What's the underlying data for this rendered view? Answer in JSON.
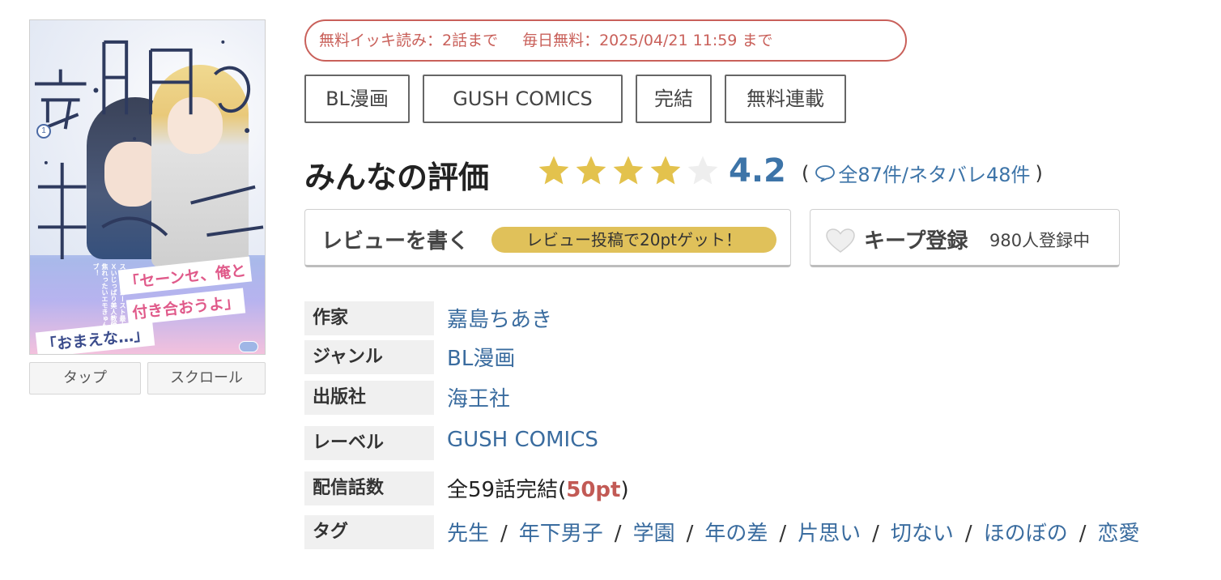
{
  "cover": {
    "volume": "1",
    "band_line1": "「セーンセ、俺と",
    "band_line2": "付き合おうよ」",
    "band_line3": "「おまえな…」",
    "blurb": "スクールカースト最上位Ｘいじっぱり美人教師の焦れったいエモきゅんラブ！"
  },
  "cover_buttons": {
    "tap": "タップ",
    "scroll": "スクロール"
  },
  "free_badge": {
    "part1": "無料イッキ読み：2話まで",
    "part2": "毎日無料：2025/04/21 11:59 まで"
  },
  "tags_top": [
    "BL漫画",
    "GUSH COMICS",
    "完結",
    "無料連載"
  ],
  "rating": {
    "label": "みんなの評価",
    "score": "4.2",
    "stars_filled": 4,
    "stars_total": 5,
    "open_paren": "(",
    "close_paren": ")",
    "counts": "全87件/ネタバレ48件"
  },
  "review": {
    "label": "レビューを書く",
    "promo": "レビュー投稿で20ptゲット！"
  },
  "keep": {
    "label": "キープ登録",
    "count": "980人登録中"
  },
  "info": {
    "author_key": "作家",
    "author": "嘉島ちあき",
    "genre_key": "ジャンル",
    "genre": "BL漫画",
    "publisher_key": "出版社",
    "publisher": "海王社",
    "label_key": "レーベル",
    "label": "GUSH COMICS",
    "episodes_key": "配信話数",
    "episodes_prefix": "全59話完結(",
    "episodes_pt": "50pt",
    "episodes_suffix": ")",
    "tags_key": "タグ",
    "tags": [
      "先生",
      "年下男子",
      "学園",
      "年の差",
      "片思い",
      "切ない",
      "ほのぼの",
      "恋愛"
    ],
    "tag_separator": "/"
  },
  "colors": {
    "link": "#3a6c9f",
    "accent_red": "#c9605a",
    "star": "#e3c24d",
    "promo_pill": "#e0c15a"
  }
}
